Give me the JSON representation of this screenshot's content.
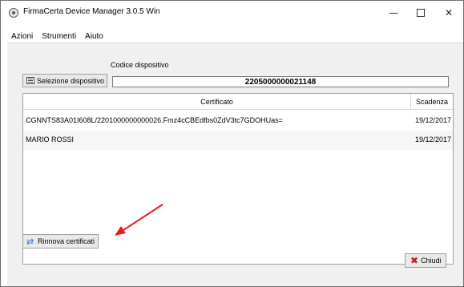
{
  "window": {
    "title": "FirmaCerta Device Manager 3.0.5 Win",
    "minimize": "—",
    "close": "✕"
  },
  "menu": [
    "Azioni",
    "Strumenti",
    "Aiuto"
  ],
  "device": {
    "codice_label": "Codice dispositivo",
    "select_button": "Selezione dispositivo",
    "codice_value": "2205000000021148"
  },
  "table": {
    "headers": [
      "Certificato",
      "Scadenza"
    ],
    "rows": [
      {
        "certificato": "CGNNTS83A01I608L/2201000000000026.Fmz4cCBEdfbs0ZdV3tc7GDOHUas=",
        "scadenza": "19/12/2017"
      },
      {
        "certificato": "MARIO ROSSI",
        "scadenza": "19/12/2017"
      }
    ]
  },
  "buttons": {
    "renew": "Rinnova certificati",
    "close": "Chiudi"
  },
  "icons": {
    "app": "app-logo-icon",
    "select": "list-icon",
    "renew": "refresh-icon",
    "close": "red-x-icon",
    "annotation": "red-arrow"
  },
  "colors": {
    "annotation_arrow": "#e02020",
    "renew_icon": "#2b6cc4",
    "close_icon": "#c62020"
  }
}
